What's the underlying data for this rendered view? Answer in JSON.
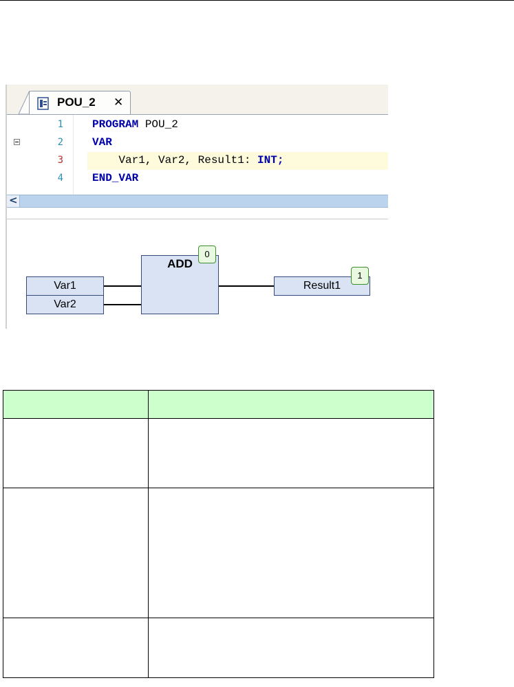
{
  "editor": {
    "tab": {
      "title": "POU_2",
      "close_glyph": "✕"
    },
    "code_lines": [
      {
        "number": "1",
        "tokens": [
          {
            "text": "PROGRAM",
            "kw": true
          },
          {
            "text": " POU_2",
            "kw": false
          }
        ]
      },
      {
        "number": "2",
        "tokens": [
          {
            "text": "VAR",
            "kw": true
          }
        ]
      },
      {
        "number": "3",
        "tokens": [
          {
            "text": "    Var1, Var2, Result1: ",
            "kw": false
          },
          {
            "text": "INT;",
            "kw": true
          }
        ]
      },
      {
        "number": "4",
        "tokens": [
          {
            "text": "END_VAR",
            "kw": true
          }
        ]
      }
    ],
    "scroll_left_glyph": "<"
  },
  "diagram": {
    "inputs": [
      "Var1",
      "Var2"
    ],
    "block": {
      "name": "ADD",
      "badge": "0"
    },
    "output": {
      "name": "Result1",
      "badge": "1"
    }
  },
  "table": {
    "header": [
      "",
      ""
    ],
    "rows": [
      [
        "",
        ""
      ],
      [
        "",
        ""
      ],
      [
        "",
        ""
      ]
    ]
  },
  "colors": {
    "keyword": "#0000aa",
    "line_number": "#2b91af",
    "fbd_fill": "#d9e3f3",
    "badge_fill": "#e9f8e1",
    "table_header": "#ccffcc"
  }
}
